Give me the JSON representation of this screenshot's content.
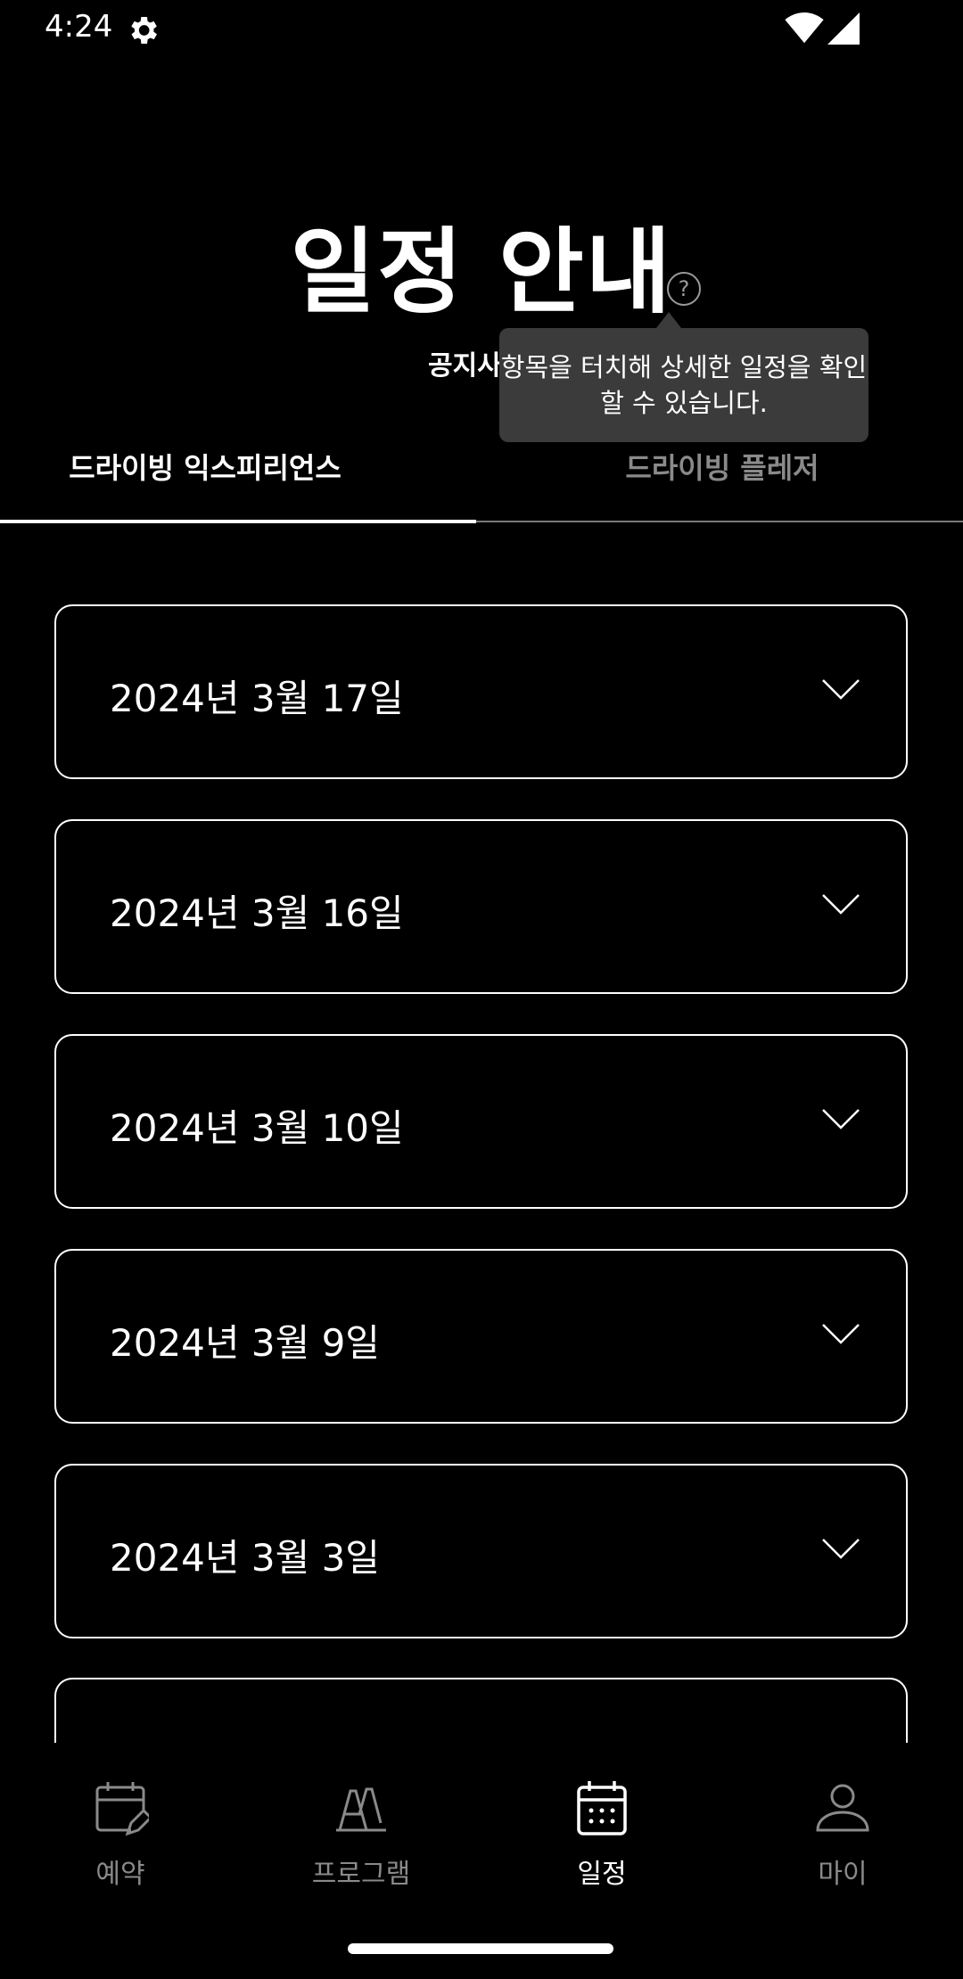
{
  "status_bar": {
    "time": "4:24"
  },
  "page": {
    "title": "일정 안내",
    "subtitle": "공지사",
    "tooltip": "항목을 터치해 상세한 일정을 확인할 수 있습니다."
  },
  "tabs": [
    {
      "label": "드라이빙 익스피리언스",
      "active": true
    },
    {
      "label": "드라이빙 플레저",
      "active": false
    }
  ],
  "schedule": [
    {
      "date": "2024년 3월 17일"
    },
    {
      "date": "2024년 3월 16일"
    },
    {
      "date": "2024년 3월 10일"
    },
    {
      "date": "2024년 3월 9일"
    },
    {
      "date": "2024년 3월 3일"
    }
  ],
  "bottom_nav": [
    {
      "label": "예약",
      "icon": "calendar-edit-icon",
      "active": false
    },
    {
      "label": "프로그램",
      "icon": "traffic-cones-icon",
      "active": false
    },
    {
      "label": "일정",
      "icon": "calendar-icon",
      "active": true
    },
    {
      "label": "마이",
      "icon": "person-icon",
      "active": false
    }
  ],
  "colors": {
    "background": "#000000",
    "text": "#ffffff",
    "inactive": "#8a8a8a",
    "tooltip_bg": "#3b3b3b"
  }
}
